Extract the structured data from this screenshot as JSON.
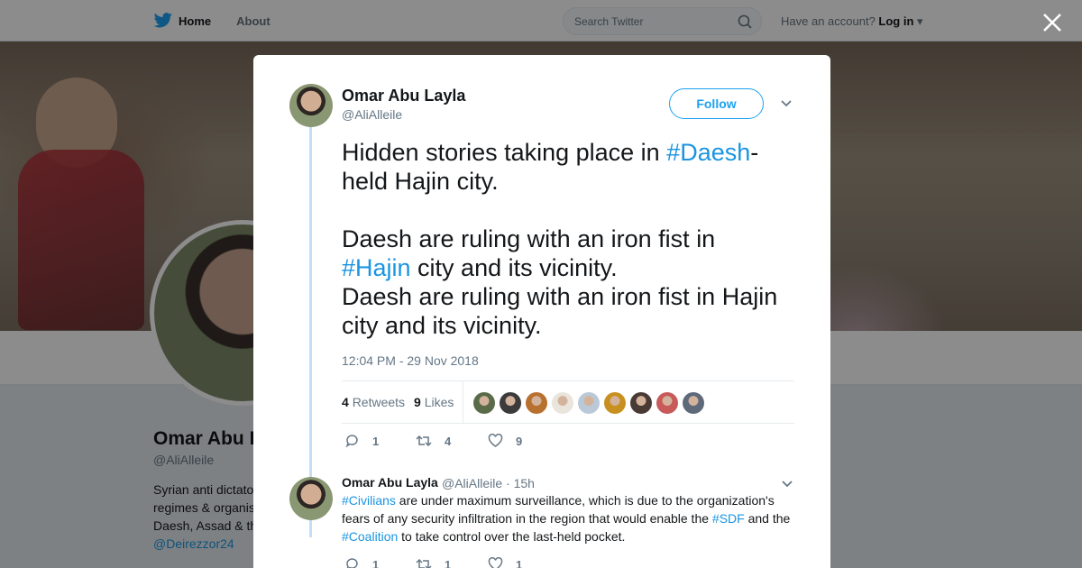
{
  "nav": {
    "home_label": "Home",
    "about_label": "About",
    "search_placeholder": "Search Twitter",
    "account_prompt": "Have an account?",
    "login_label": "Log in"
  },
  "profile": {
    "name": "Omar Abu L",
    "handle": "@AliAlleile",
    "bio_lines": [
      "Syrian anti dictato",
      "regimes & organis",
      "Daesh, Assad & th"
    ],
    "bio_link": "@Deirezzor24"
  },
  "tweet": {
    "author_name": "Omar Abu Layla",
    "author_handle": "@AliAlleile",
    "follow_label": "Follow",
    "text_p1": "Hidden stories taking place in ",
    "tag1": "#Daesh",
    "text_p2": "-\nheld Hajin city.\n\nDaesh are ruling with an iron fist in\n",
    "tag2": "#Hajin",
    "text_p3": " city and its vicinity.\nDaesh are ruling with an iron fist in Hajin\ncity and its vicinity.",
    "timestamp": "12:04 PM - 29 Nov 2018",
    "retweets_count": "4",
    "retweets_label": "Retweets",
    "likes_count": "9",
    "likes_label": "Likes",
    "liker_colors": [
      "#5a6b4a",
      "#3b3b3b",
      "#b8702e",
      "#e9e4dc",
      "#b9c9d8",
      "#c8901e",
      "#4a3a35",
      "#c85a5a",
      "#5e6a7a"
    ],
    "actions": {
      "replies": "1",
      "retweets": "4",
      "likes": "9"
    }
  },
  "reply": {
    "author_name": "Omar Abu Layla",
    "meta": "@AliAlleile · 15h",
    "tag1": "#Civilians",
    "t1": " are under maximum surveillance, which is due to the organization's fears of any security infiltration in the region that would enable the ",
    "tag2": "#SDF",
    "t2": " and the ",
    "tag3": "#Coalition",
    "t3": " to take control over the last-held pocket.",
    "actions": {
      "replies": "1",
      "retweets": "1",
      "likes": "1"
    }
  }
}
